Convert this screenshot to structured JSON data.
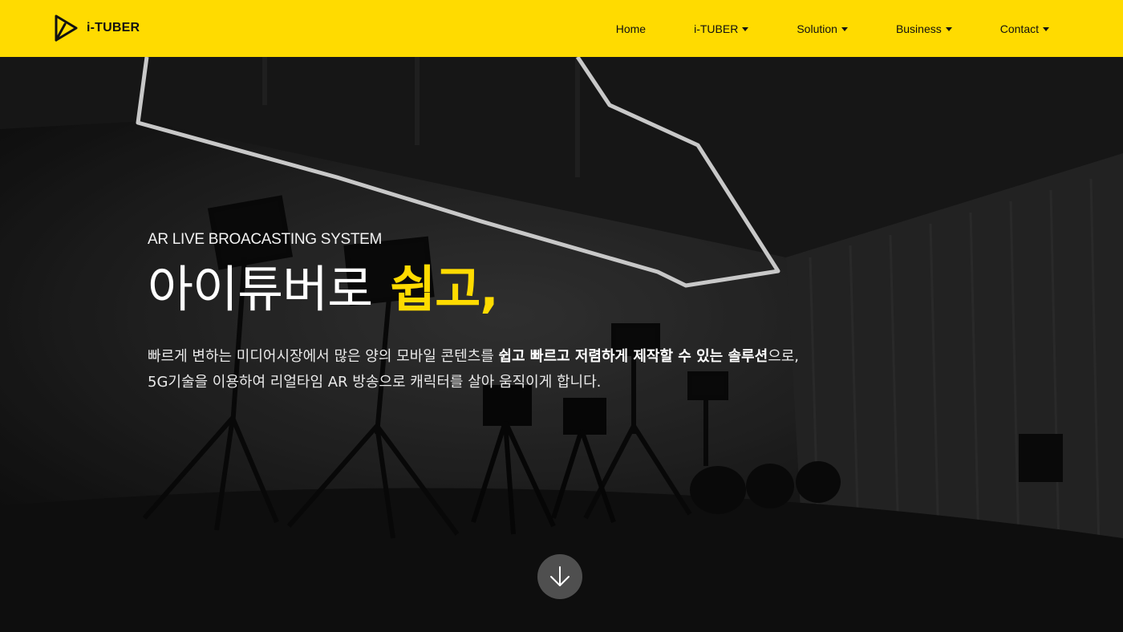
{
  "header": {
    "brand": "i-TUBER",
    "nav": [
      {
        "label": "Home",
        "has_dropdown": false
      },
      {
        "label": "i-TUBER",
        "has_dropdown": true
      },
      {
        "label": "Solution",
        "has_dropdown": true
      },
      {
        "label": "Business",
        "has_dropdown": true
      },
      {
        "label": "Contact",
        "has_dropdown": true
      }
    ]
  },
  "hero": {
    "subtitle": "AR LIVE BROACASTING SYSTEM",
    "headline_main": "아이튜버로",
    "headline_accent": "쉽고,",
    "desc_line1_a": "빠르게 변하는 미디어시장에서 많은 양의 모바일 콘텐츠를 ",
    "desc_line1_bold": "쉽고 빠르고 저렴하게 제작할 수 있는 솔루션",
    "desc_line1_b": "으로,",
    "desc_line2": "5G기술을 이용하여 리얼타임 AR 방송으로 캐릭터를 살아 움직이게 합니다.",
    "scroll_icon": "arrow-down-icon"
  },
  "colors": {
    "accent": "#ffdb00",
    "text_dark": "#111111",
    "text_light": "#ffffff"
  }
}
